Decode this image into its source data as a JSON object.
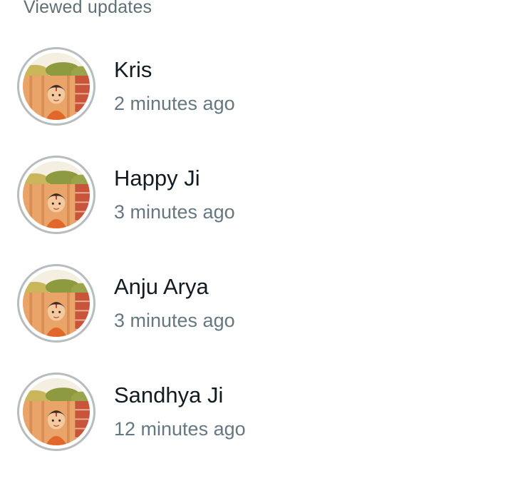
{
  "section": {
    "title": "Viewed updates"
  },
  "statuses": [
    {
      "name": "Kris",
      "time": "2 minutes ago"
    },
    {
      "name": "Happy Ji",
      "time": "3 minutes ago"
    },
    {
      "name": "Anju Arya",
      "time": "3 minutes ago"
    },
    {
      "name": "Sandhya Ji",
      "time": "12 minutes ago"
    }
  ],
  "colors": {
    "viewed_ring": "#b7bcbf",
    "name_text": "#111b21",
    "time_text": "#667781",
    "header_text": "#5f6f77"
  },
  "avatar_icon": "cartoon-child-avatar-icon"
}
